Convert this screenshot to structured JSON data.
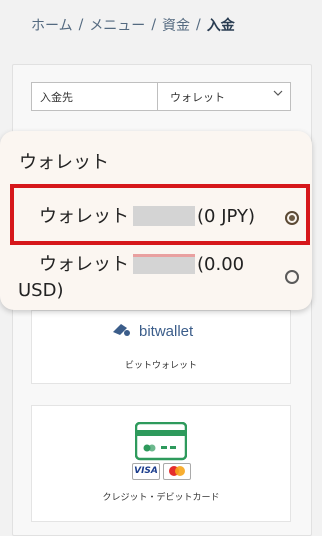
{
  "breadcrumb": {
    "home": "ホーム",
    "menu": "メニュー",
    "funds": "資金",
    "current": "入金",
    "separator": "/"
  },
  "deposit_target": {
    "label": "入金先",
    "selected": "ウォレット"
  },
  "sheet": {
    "title": "ウォレット",
    "options": [
      {
        "label": "ウォレット",
        "suffix": "(0 JPY)",
        "selected": true
      },
      {
        "label": "ウォレット",
        "suffix": "(0.00",
        "suffix2": "USD)",
        "selected": false
      }
    ]
  },
  "methods": [
    {
      "logo_text": "bitwallet",
      "caption": "ビットウォレット"
    },
    {
      "caption": "クレジット・デビットカード",
      "brands": [
        "VISA",
        "Mastercard"
      ]
    }
  ],
  "colors": {
    "highlight": "#d6171b",
    "sheet_bg": "#fbf6f1",
    "page_bg": "#f2f2f2",
    "radio_selected": "#6b5a43",
    "card_icon_green": "#2e9a5c"
  },
  "icons": [
    "chevron-down-icon",
    "bitwallet-logo-icon",
    "credit-card-icon",
    "visa-icon",
    "mastercard-icon",
    "radio-selected-icon",
    "radio-unselected-icon"
  ]
}
